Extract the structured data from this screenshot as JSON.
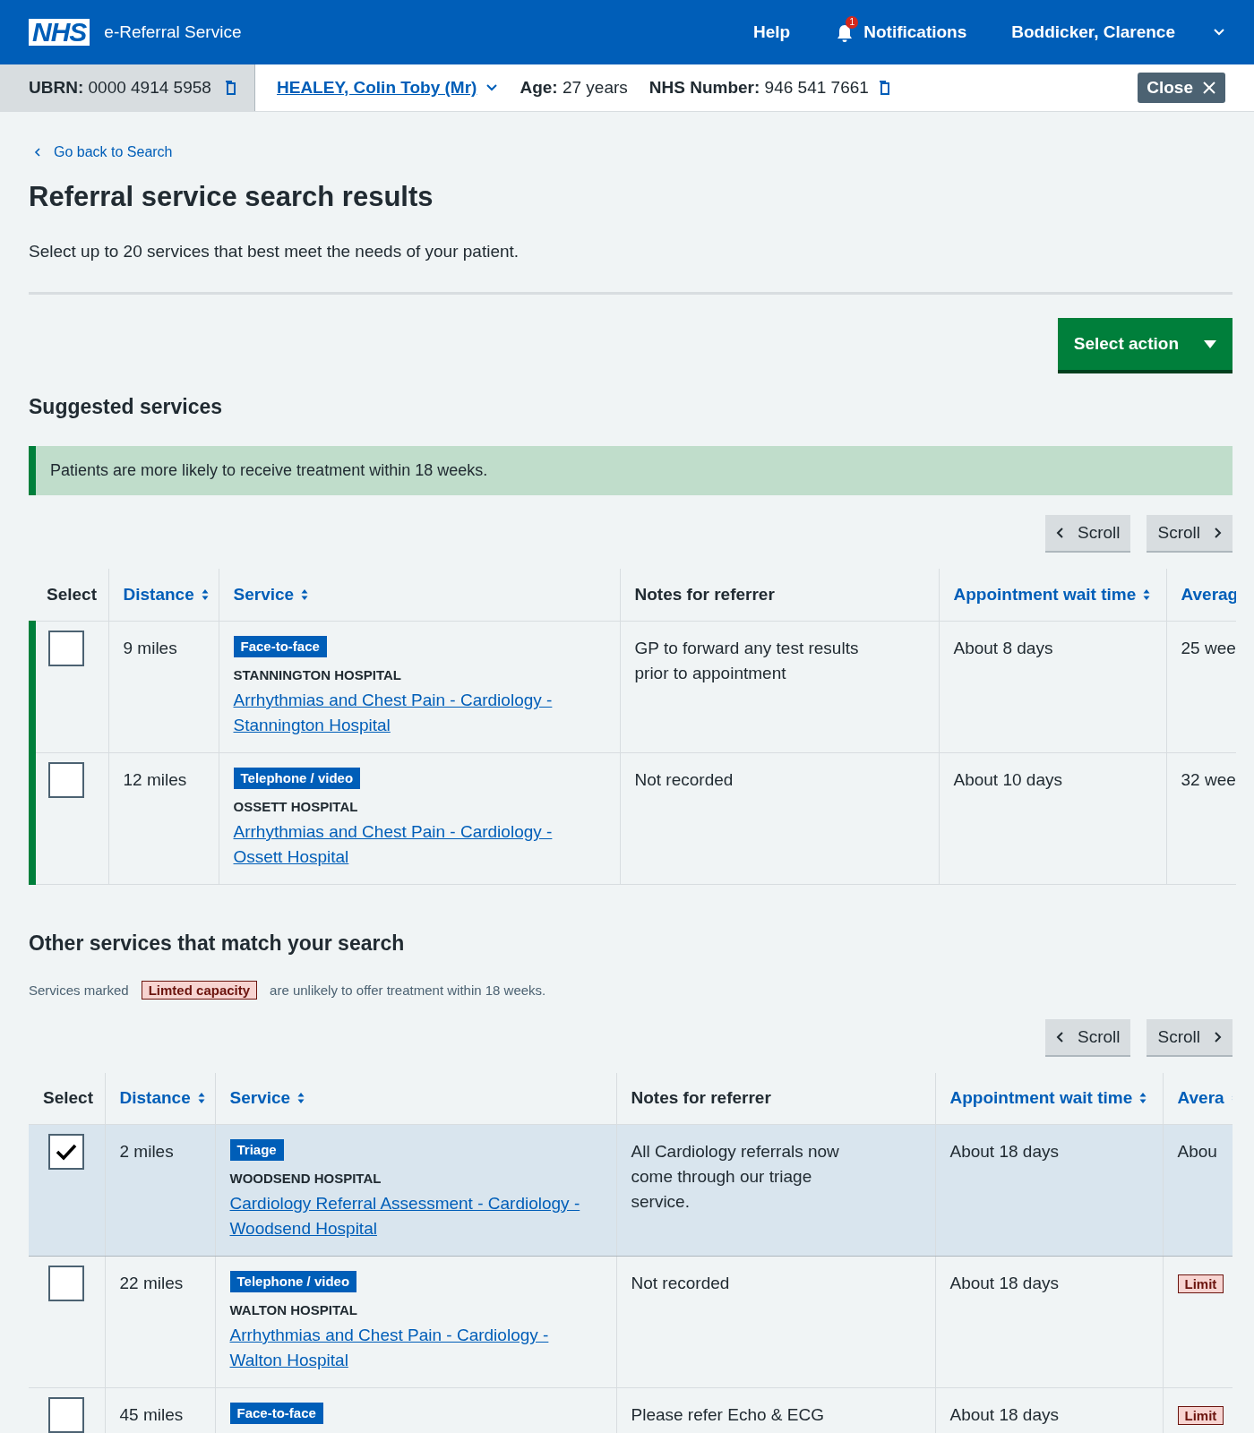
{
  "header": {
    "logo": "NHS",
    "service_name": "e-Referral Service",
    "nav": [
      {
        "kind": "link",
        "label": "Help"
      },
      {
        "kind": "notifications",
        "label": "Notifications",
        "badge": "1"
      },
      {
        "kind": "user",
        "label": "Boddicker, Clarence"
      }
    ]
  },
  "patient_bar": {
    "ubrn": "**UBRN:** 0000 4914 5958",
    "patient_name": "HEALEY, Colin Toby (Mr)",
    "age": "**Age:** 27 years",
    "nhs_number": "**NHS Number:** 946 541 7661",
    "close_button": "Close"
  },
  "back_link": "Go back to Search",
  "title": "Referral service search results",
  "intro": "Select up to 20 services that best meet the needs of your patient.",
  "select_action": "Select action",
  "sections": [
    {
      "heading": "Suggested services",
      "suggested": true,
      "inset": "Patients are more likely to receive treatment within 18 weeks.",
      "scroll_buttons": [
        "Scroll",
        "Scroll"
      ],
      "columns": [
        {
          "label": "Select",
          "sortable": false
        },
        {
          "label": "Distance",
          "sortable": true
        },
        {
          "label": "Service",
          "sortable": true
        },
        {
          "label": "Notes for referrer",
          "sortable": false
        },
        {
          "label": "Appointment wait time",
          "sortable": true
        },
        {
          "label": "Averag",
          "sortable": true
        }
      ],
      "rows": [
        {
          "selected": false,
          "distance": "9 miles",
          "tag": "Face-to-face",
          "hospital": "STANNINGTON HOSPITAL",
          "service": "Arrhythmias and Chest Pain - Cardiology - Stannington Hospital",
          "notes": "GP to forward any test results prior to appointment",
          "wait": "About 8 days",
          "column_6": {
            "kind": "text",
            "text": "25 wee"
          }
        },
        {
          "selected": false,
          "distance": "12 miles",
          "tag": "Telephone / video",
          "hospital": "OSSETT HOSPITAL",
          "service": "Arrhythmias and Chest Pain - Cardiology - Ossett Hospital",
          "notes": "Not recorded",
          "wait": "About 10 days",
          "column_6": {
            "kind": "text",
            "text": "32 wee"
          }
        }
      ]
    },
    {
      "heading": "Other services that match your search",
      "suggested": false,
      "note": {
        "before": "Services marked",
        "tag": "Limted capacity",
        "after": "are unlikely to offer treatment within 18 weeks."
      },
      "scroll_buttons": [
        "Scroll",
        "Scroll"
      ],
      "columns": [
        {
          "label": "Select",
          "sortable": false
        },
        {
          "label": "Distance",
          "sortable": true
        },
        {
          "label": "Service",
          "sortable": true
        },
        {
          "label": "Notes for referrer",
          "sortable": false
        },
        {
          "label": "Appointment wait time",
          "sortable": true
        },
        {
          "label": "Avera",
          "sortable": true
        }
      ],
      "rows": [
        {
          "selected": true,
          "distance": "2 miles",
          "tag": "Triage",
          "hospital": "WOODSEND HOSPITAL",
          "service": "Cardiology Referral Assessment - Cardiology - Woodsend Hospital",
          "notes": "All Cardiology referrals now come through our triage service.",
          "wait": "About 18 days",
          "column_6": {
            "kind": "text",
            "text": "Abou"
          }
        },
        {
          "selected": false,
          "distance": "22 miles",
          "tag": "Telephone / video",
          "hospital": "WALTON HOSPITAL",
          "service": "Arrhythmias and Chest Pain - Cardiology - Walton Hospital",
          "notes": "Not recorded",
          "wait": "About 18 days",
          "column_6": {
            "kind": "capacity",
            "text": "Limit"
          }
        },
        {
          "selected": false,
          "distance": "45 miles",
          "tag": "Face-to-face",
          "notes": "Please refer Echo & ECG",
          "wait": "About 18 days",
          "column_6": {
            "kind": "capacity",
            "text": "Limit"
          }
        }
      ]
    }
  ]
}
